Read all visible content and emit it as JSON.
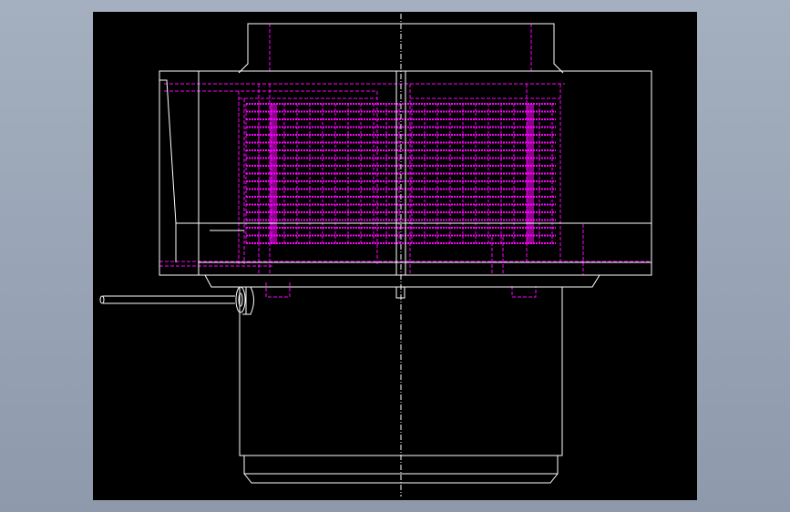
{
  "viewer": {
    "background_gradient": [
      "#a4afbf",
      "#8e9aac"
    ],
    "viewport_color": "#000000"
  },
  "drawing": {
    "visible_edge_color": "#ffffff",
    "hidden_edge_color": "#ff00ff",
    "centerline_color": "#ffffff",
    "view": "front-elevation"
  }
}
